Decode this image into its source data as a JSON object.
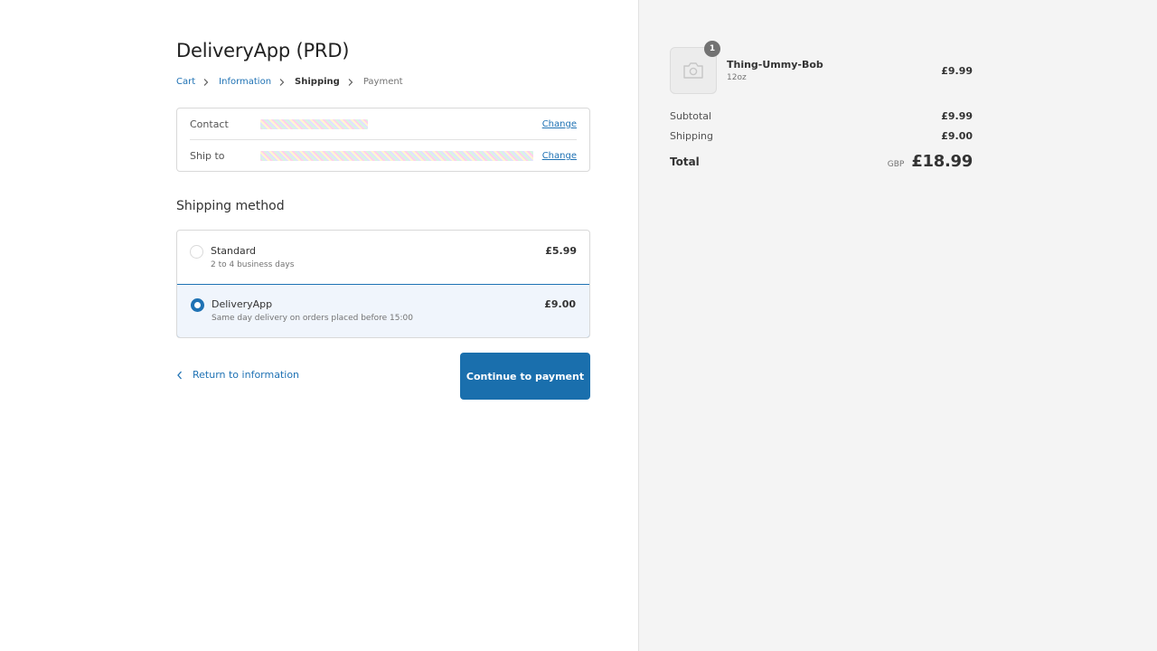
{
  "store": {
    "title": "DeliveryApp (PRD)"
  },
  "breadcrumb": {
    "items": [
      {
        "label": "Cart",
        "state": "link"
      },
      {
        "label": "Information",
        "state": "link"
      },
      {
        "label": "Shipping",
        "state": "current"
      },
      {
        "label": "Payment",
        "state": "future"
      }
    ]
  },
  "review": {
    "contact_label": "Contact",
    "contact_value": "[redacted]",
    "ship_to_label": "Ship to",
    "ship_to_value": "[redacted]",
    "change_label": "Change"
  },
  "shipping": {
    "section_title": "Shipping method",
    "methods": [
      {
        "name": "Standard",
        "description": "2 to 4 business days",
        "price": "£5.99",
        "selected": false
      },
      {
        "name": "DeliveryApp",
        "description": "Same day delivery on orders placed before 15:00",
        "price": "£9.00",
        "selected": true
      }
    ]
  },
  "actions": {
    "return_label": "Return to information",
    "continue_label": "Continue to payment"
  },
  "order": {
    "items": [
      {
        "name": "Thing-Ummy-Bob",
        "variant": "12oz",
        "price": "£9.99",
        "quantity": "1",
        "image_icon": "camera-icon"
      }
    ],
    "subtotal_label": "Subtotal",
    "subtotal": "£9.99",
    "shipping_label": "Shipping",
    "shipping": "£9.00",
    "total_label": "Total",
    "currency": "GBP",
    "total": "£18.99"
  },
  "colors": {
    "accent": "#1f72b4",
    "button": "#1a6fad",
    "selected_bg": "#f0f5fc",
    "sidebar_bg": "#f4f4f4"
  }
}
